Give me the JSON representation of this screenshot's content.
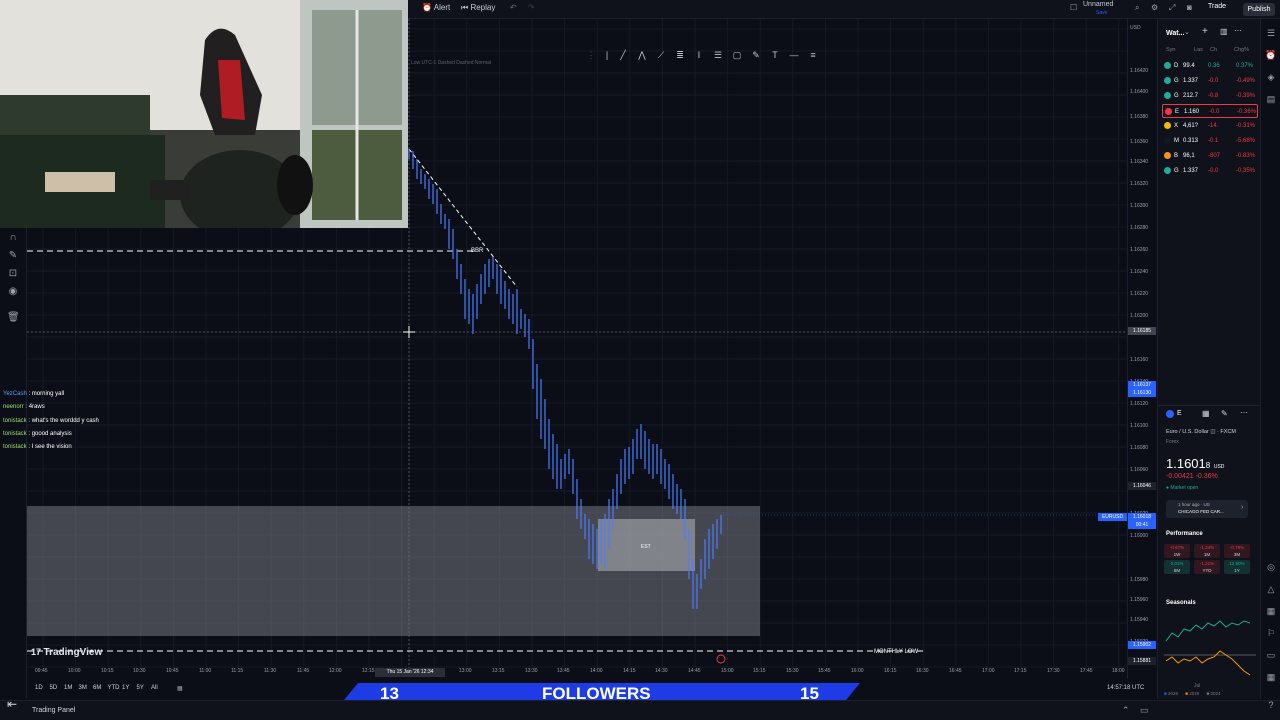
{
  "topbar": {
    "alert": "Alert",
    "replay": "Replay",
    "layout_name": "Unnamed",
    "layout_sub": "Save",
    "trade": "Trade",
    "publish": "Publish"
  },
  "chart_header": {
    "legend": "Low UTC-1 Dashed Dashed Normal"
  },
  "chat": {
    "messages": [
      {
        "user": "YezCash",
        "text": " : morning yall",
        "color": "blue"
      },
      {
        "user": "neenorr",
        "text": " : 4raws",
        "color": "green"
      },
      {
        "user": "tonistack",
        "text": " : what's the worddd y cash",
        "color": "green"
      },
      {
        "user": "tonistack",
        "text": " : goood analysis",
        "color": "green"
      },
      {
        "user": "tonistack",
        "text": " : I see the vision",
        "color": "green"
      }
    ]
  },
  "annotations": {
    "bbr": "BBR",
    "eqh_box": "EST",
    "monthly_low": "MONTHLY LOW",
    "watermark": "TradingView"
  },
  "price_axis": {
    "currency": "USD",
    "labels": [
      "1.16420",
      "1.16400",
      "1.16380",
      "1.16360",
      "1.16340",
      "1.16320",
      "1.16300",
      "1.16280",
      "1.16260",
      "1.16240",
      "1.16220",
      "1.16200",
      "1.16185",
      "1.16160",
      "1.16140",
      "1.16120",
      "1.16100",
      "1.16080",
      "1.16060",
      "1.16040",
      "1.16020",
      "1.16000",
      "1.15980",
      "1.15960",
      "1.15940",
      "1.15920",
      "1.15900",
      "1.15881"
    ],
    "current_tag_symbol": "EURUSD",
    "current_tag_price": "1.16018",
    "current_tag_time": "00:41",
    "crosshair_price": "1.16185",
    "blue_tag_1": "1.16137",
    "blue_tag_2": "1.16130",
    "blue_tag_low": "1.15902",
    "low_tag": "1.15881",
    "mid_tag": "1.16046"
  },
  "time_axis": {
    "labels": [
      "09:45",
      "10:00",
      "10:15",
      "10:30",
      "10:45",
      "11:00",
      "11:15",
      "11:30",
      "11:45",
      "12:00",
      "12:15",
      "13:00",
      "13:15",
      "13:30",
      "13:45",
      "14:00",
      "14:15",
      "14:30",
      "14:45",
      "15:00",
      "15:15",
      "15:30",
      "15:45",
      "16:00",
      "16:15",
      "16:30",
      "16:45",
      "17:00",
      "17:15",
      "17:30",
      "17:45",
      "18:00"
    ],
    "cursor_date": "Thu 15 Jan '26",
    "cursor_time": "12:34"
  },
  "bottom_bar": {
    "ranges": [
      "1D",
      "5D",
      "1M",
      "3M",
      "6M",
      "YTD",
      "1Y",
      "5Y",
      "All"
    ],
    "clock": "14:57:18 UTC",
    "panel_tab": "Trading Panel"
  },
  "followers": {
    "left": "13",
    "label": "FOLLOWERS",
    "right": "15"
  },
  "watchlist": {
    "title": "Wat...",
    "columns": [
      "Syn",
      "Las",
      "Ch",
      "Chg%"
    ],
    "rows": [
      {
        "sym": "D",
        "last": "99.4",
        "chg": "0.36",
        "pct": "0.37%",
        "dir": "pos",
        "dot": "#22ab94"
      },
      {
        "sym": "G",
        "last": "1.337",
        "chg": "-0.0",
        "pct": "-0.49%",
        "dir": "neg",
        "dot": "#22ab94"
      },
      {
        "sym": "G",
        "last": "212.7",
        "chg": "-0.8",
        "pct": "-0.39%",
        "dir": "neg",
        "dot": "#22ab94"
      },
      {
        "sym": "E",
        "last": "1.160",
        "chg": "-0.0",
        "pct": "-0.36%",
        "dir": "neg",
        "dot": "#f23645"
      },
      {
        "sym": "X",
        "last": "4,61?",
        "chg": "-14.",
        "pct": "-0.31%",
        "dir": "neg",
        "dot": "#f0b90b"
      },
      {
        "sym": "M",
        "last": "0.313",
        "chg": "-0.1",
        "pct": "-5.68%",
        "dir": "neg",
        "dot": "#131722"
      },
      {
        "sym": "B",
        "last": "96,1",
        "chg": "-807",
        "pct": "-0.83%",
        "dir": "neg",
        "dot": "#f7931a"
      },
      {
        "sym": "G",
        "last": "1.337",
        "chg": "-0.0",
        "pct": "-0.35%",
        "dir": "neg",
        "dot": "#22ab94"
      }
    ]
  },
  "details": {
    "symbol_short": "E",
    "name": "Euro / U.S. Dollar",
    "exchange": "FXCM",
    "type": "Forex",
    "price_main": "1.1601",
    "price_tail": "8",
    "price_ccy": "USD",
    "change": "-0.00421",
    "change_pct": "-0.36%",
    "market": "Market open",
    "news_time": "1 hour ago · US",
    "news_title": "CHICAGO FED CAR...",
    "performance_title": "Performance",
    "perf": [
      {
        "val": "-0.67%",
        "per": "1W",
        "dir": "neg"
      },
      {
        "val": "-1.34%",
        "per": "1M",
        "dir": "neg"
      },
      {
        "val": "-0.78%",
        "per": "3M",
        "dir": "neg"
      },
      {
        "val": "0.01%",
        "per": "6M",
        "dir": "pos"
      },
      {
        "val": "-1.21%",
        "per": "YTD",
        "dir": "neg"
      },
      {
        "val": "12.50%",
        "per": "1Y",
        "dir": "pos"
      }
    ],
    "seasonals_title": "Seasonals",
    "seasonals_month": "Jul",
    "seasonals_years": [
      "2026",
      "2025",
      "2024"
    ]
  },
  "colors": {
    "bg": "#0b0e16",
    "candle": "#4d7cff",
    "zone": "#8a8d96",
    "accent_blue": "#2962ff",
    "followers_bar": "#1e3ce6",
    "neg": "#f23645",
    "pos": "#22ab94"
  }
}
